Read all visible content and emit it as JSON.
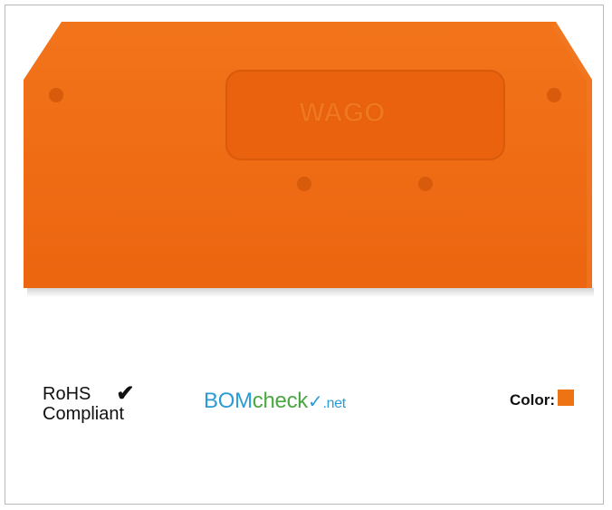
{
  "product": {
    "logo_text": "WAGO",
    "plate_color": "#ee6a12",
    "image_alt": "orange end plate"
  },
  "rohs": {
    "line1": "RoHS",
    "line2": "Compliant",
    "check_icon": "checkmark-icon"
  },
  "bomcheck": {
    "part1": "BOM",
    "part2": "check",
    "tick": "✓",
    "suffix": ".net",
    "blue": "#2d9bd3",
    "green": "#4aa843"
  },
  "color_info": {
    "label": "Color:",
    "swatch": "#ee7312"
  }
}
